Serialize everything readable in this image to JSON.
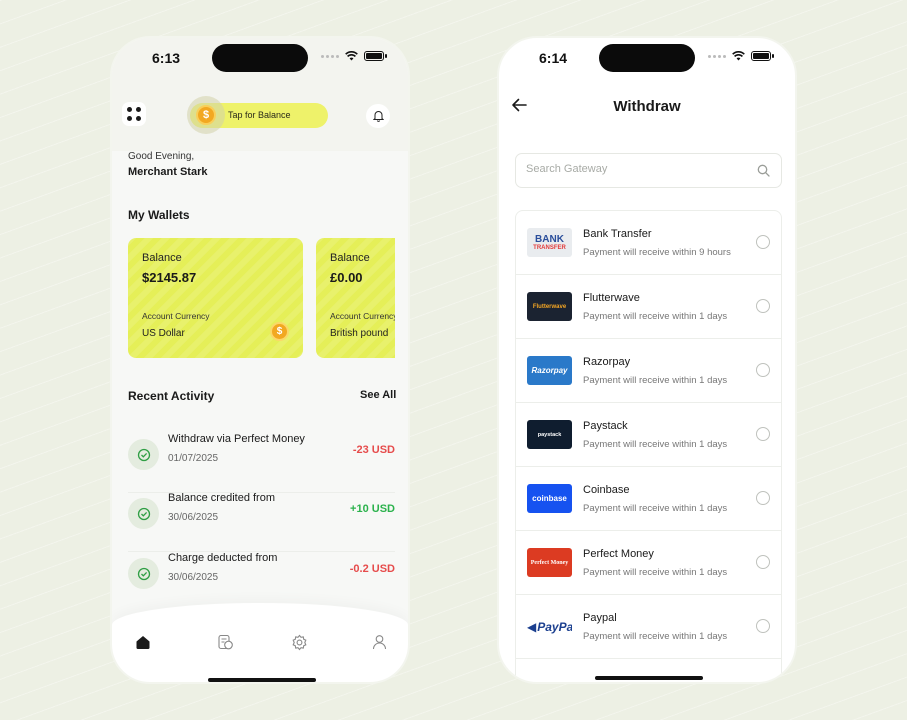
{
  "home": {
    "status_time": "6:13",
    "balance_pill": "Tap for Balance",
    "coin_symbol": "$",
    "greeting": "Good Evening,",
    "merchant_name": "Merchant Stark",
    "wallets_title": "My Wallets",
    "wallets": [
      {
        "label": "Balance",
        "amount": "$2145.87",
        "currency_label": "Account Currency",
        "currency": "US Dollar",
        "coin": "$"
      },
      {
        "label": "Balance",
        "amount": "£0.00",
        "currency_label": "Account Currency",
        "currency": "British pound"
      }
    ],
    "recent_title": "Recent Activity",
    "see_all": "See All",
    "activities": [
      {
        "title": "Withdraw via Perfect Money",
        "date": "01/07/2025",
        "amount": "-23 USD",
        "type": "debit"
      },
      {
        "title": "Balance credited from",
        "date": "30/06/2025",
        "amount": "+10 USD",
        "type": "credit"
      },
      {
        "title": "Charge deducted from",
        "date": "30/06/2025",
        "amount": "-0.2 USD",
        "type": "debit"
      }
    ],
    "nav": [
      "home-icon",
      "receipt-icon",
      "settings-icon",
      "profile-icon"
    ]
  },
  "withdraw": {
    "status_time": "6:14",
    "title": "Withdraw",
    "search_placeholder": "Search Gateway",
    "gateways": [
      {
        "name": "Bank Transfer",
        "note": "Payment will receive within 9 hours",
        "logo_text_1": "BANK",
        "logo_text_2": "TRANSFER",
        "logo_bg": "#e9ecef"
      },
      {
        "name": "Flutterwave",
        "note": "Payment will receive within 1 days",
        "logo_text": "Flutterwave",
        "logo_bg": "#1b2331"
      },
      {
        "name": "Razorpay",
        "note": "Payment will receive within 1 days",
        "logo_text": "Razorpay",
        "logo_bg": "#2a79c9"
      },
      {
        "name": "Paystack",
        "note": "Payment will receive within 1 days",
        "logo_text": "paystack",
        "logo_bg": "#0f1d2f"
      },
      {
        "name": "Coinbase",
        "note": "Payment will receive within 1 days",
        "logo_text": "coinbase",
        "logo_bg": "#1652f0"
      },
      {
        "name": "Perfect Money",
        "note": "Payment will receive within 1 days",
        "logo_text": "Perfect Money",
        "logo_bg": "#dc3b22"
      },
      {
        "name": "Paypal",
        "note": "Payment will receive within 1 days",
        "logo_text": "PayPa",
        "logo_bg": "#ffffff"
      }
    ]
  },
  "colors": {
    "accent": "#e5ef58",
    "debit": "#e64b4b",
    "credit": "#2bb24c"
  }
}
